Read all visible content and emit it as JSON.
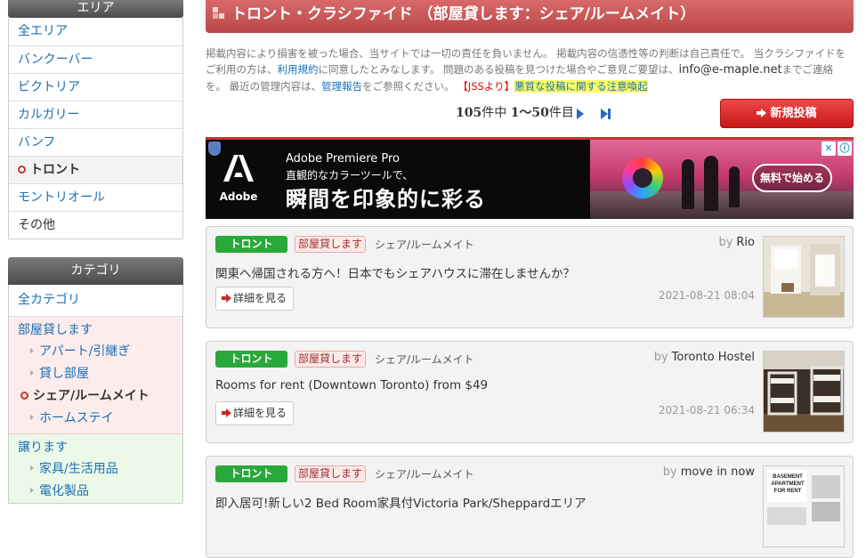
{
  "sidebar": {
    "area_header": "エリア",
    "areas": [
      {
        "label": "全エリア",
        "active": false
      },
      {
        "label": "バンクーバー",
        "active": false
      },
      {
        "label": "ビクトリア",
        "active": false
      },
      {
        "label": "カルガリー",
        "active": false
      },
      {
        "label": "バンフ",
        "active": false
      },
      {
        "label": "トロント",
        "active": true
      },
      {
        "label": "モントリオール",
        "active": false
      },
      {
        "label": "その他",
        "active": false
      }
    ],
    "category_header": "カテゴリ",
    "category_all": "全カテゴリ",
    "group1": {
      "label": "部屋貸します",
      "items": [
        "アパート/引継ぎ",
        "貸し部屋",
        "シェア/ルームメイト",
        "ホームステイ"
      ],
      "current_index": 2
    },
    "group2": {
      "label": "譲ります",
      "items": [
        "家具/生活用品",
        "電化製品"
      ]
    }
  },
  "header": {
    "title": "トロント・クラシファイド （部屋貸します：シェア/ルームメイト）"
  },
  "notice": {
    "text1": "掲載内容により損害を被った場合、当サイトでは一切の責任を負いません。 掲載内容の信憑性等の判断は自己責任で。 当クラシファイドをご利用の方は、",
    "terms_link": "利用規約",
    "text2": "に同意したとみなします。 問題のある投稿を見つけた場合やご意見ご要望は、",
    "email": "info@e-maple.net",
    "text3": "までご連絡を。 最近の管理内容は、",
    "report_link": "管理報告",
    "text4": "をご参照ください。",
    "jss_label": "【JSSより】",
    "jss_link": "悪質な投稿に関する注意喚起"
  },
  "pager": {
    "total": "105",
    "total_suffix": "件中",
    "range": "1〜50",
    "range_suffix": "件目"
  },
  "new_post_label": "新規投稿",
  "ad": {
    "brand": "Adobe",
    "product": "Adobe Premiere Pro",
    "subtitle": "直観的なカラーツールで、",
    "headline": "瞬間を印象的に彩る",
    "cta": "無料で始める",
    "choices_icon": "ⓘ",
    "close_icon": "✕"
  },
  "listings": [
    {
      "area": "トロント",
      "category": "部屋貸します",
      "subcategory": "シェア/ルームメイト",
      "by_word": "by",
      "author": "Rio",
      "title": "関東へ帰国される方へ！日本でもシェアハウスに滞在しませんか？",
      "detail_label": "詳細を見る",
      "date": "2021-08-21 08:04"
    },
    {
      "area": "トロント",
      "category": "部屋貸します",
      "subcategory": "シェア/ルームメイト",
      "by_word": "by",
      "author": "Toronto Hostel",
      "title": "Rooms for rent (Downtown Toronto) from $49",
      "detail_label": "詳細を見る",
      "date": "2021-08-21 06:34"
    },
    {
      "area": "トロント",
      "category": "部屋貸します",
      "subcategory": "シェア/ルームメイト",
      "by_word": "by",
      "author": "move in now",
      "title": "即入居可!新しい2 Bed Room家具付Victoria Park/Sheppardエリア",
      "detail_label": "詳細を見る",
      "date": "",
      "thumb_text": "BASEMENT APARTMENT FOR RENT"
    }
  ],
  "colors": {
    "accent_red": "#c0392b",
    "title_bar": "#c95555",
    "tag_green": "#29a93a",
    "link_blue": "#1a6fb5"
  }
}
